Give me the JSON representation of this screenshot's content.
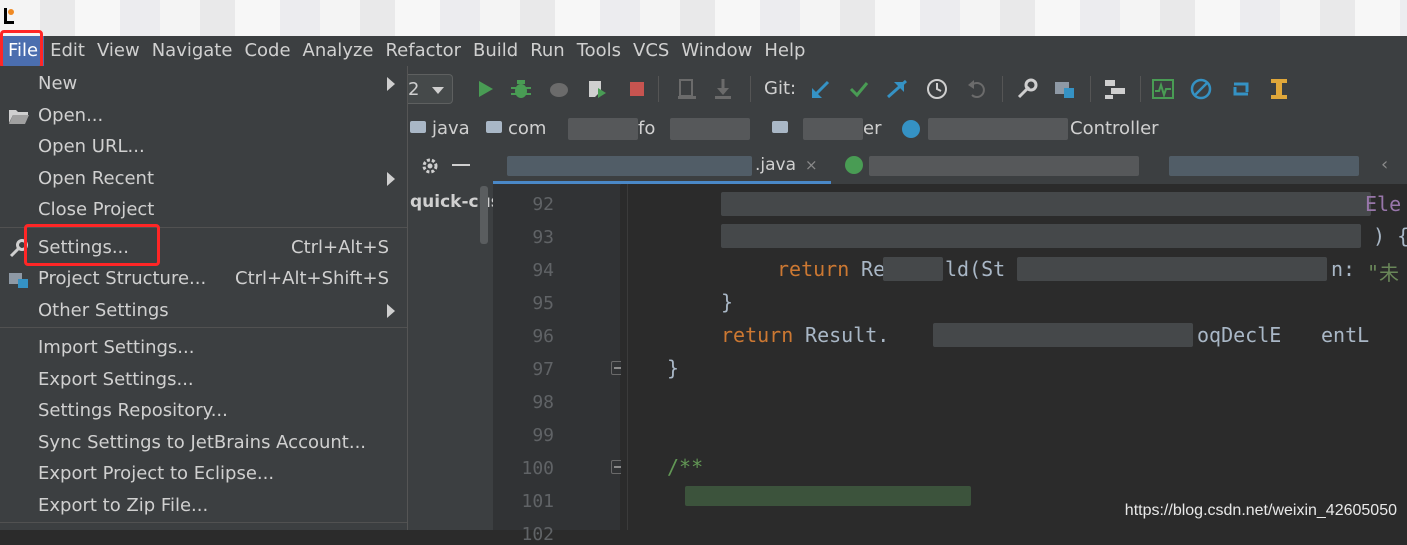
{
  "menubar": {
    "items": [
      "File",
      "Edit",
      "View",
      "Navigate",
      "Code",
      "Analyze",
      "Refactor",
      "Build",
      "Run",
      "Tools",
      "VCS",
      "Window",
      "Help"
    ]
  },
  "toolbar": {
    "run_config_value": "2",
    "git_label": "Git:",
    "icons": [
      "run-icon",
      "debug-icon",
      "coverage-icon",
      "profile-icon",
      "stop-icon",
      "git-update-icon",
      "git-commit-icon",
      "git-compare-icon",
      "history-icon",
      "rollback-icon",
      "settings-wrench-icon",
      "project-structure-icon",
      "sdk-icon",
      "monitor-icon",
      "no-entry-icon",
      "refresh-icon",
      "build-icon"
    ]
  },
  "breadcrumb": {
    "items": [
      "java",
      "com",
      "fo",
      "er",
      "Controller"
    ]
  },
  "project_panel": {
    "root_label": "quick-cust"
  },
  "tabs": {
    "active_tab": ".java"
  },
  "editor": {
    "line_numbers": [
      "92",
      "93",
      "94",
      "95",
      "96",
      "97",
      "98",
      "99",
      "100",
      "101",
      "102"
    ],
    "lines": {
      "l92": "Ele",
      "l93": ") {",
      "l94_kw": "return",
      "l94_a": " Re",
      "l94_b": "ld(St",
      "l94_c": "n: ",
      "l94_str": "\"未",
      "l95": "}",
      "l96_kw": "return",
      "l96_a": " Result.",
      "l96_b": "oqDeclE",
      "l96_c": "entL",
      "l97": "}",
      "l100": "/**"
    }
  },
  "watermark": "https://blog.csdn.net/weixin_42605050",
  "file_menu": {
    "items": [
      {
        "label": "New",
        "shortcut": "",
        "submenu": true,
        "icon": ""
      },
      {
        "label": "Open...",
        "shortcut": "",
        "submenu": false,
        "icon": "folder-open-icon"
      },
      {
        "label": "Open URL...",
        "shortcut": "",
        "submenu": false,
        "icon": ""
      },
      {
        "label": "Open Recent",
        "shortcut": "",
        "submenu": true,
        "icon": ""
      },
      {
        "label": "Close Project",
        "shortcut": "",
        "submenu": false,
        "icon": ""
      },
      {
        "label": "Settings...",
        "shortcut": "Ctrl+Alt+S",
        "submenu": false,
        "icon": "wrench-icon"
      },
      {
        "label": "Project Structure...",
        "shortcut": "Ctrl+Alt+Shift+S",
        "submenu": false,
        "icon": "project-structure-icon"
      },
      {
        "label": "Other Settings",
        "shortcut": "",
        "submenu": true,
        "icon": ""
      },
      {
        "label": "Import Settings...",
        "shortcut": "",
        "submenu": false,
        "icon": ""
      },
      {
        "label": "Export Settings...",
        "shortcut": "",
        "submenu": false,
        "icon": ""
      },
      {
        "label": "Settings Repository...",
        "shortcut": "",
        "submenu": false,
        "icon": ""
      },
      {
        "label": "Sync Settings to JetBrains Account...",
        "shortcut": "",
        "submenu": false,
        "icon": ""
      },
      {
        "label": "Export Project to Eclipse...",
        "shortcut": "",
        "submenu": false,
        "icon": ""
      },
      {
        "label": "Export to Zip File...",
        "shortcut": "",
        "submenu": false,
        "icon": ""
      }
    ]
  },
  "colors": {
    "highlight_box": "#ff2626",
    "menu_active": "#4b6eaf",
    "keyword": "#cc7832",
    "string": "#6a8759",
    "comment": "#629755"
  }
}
